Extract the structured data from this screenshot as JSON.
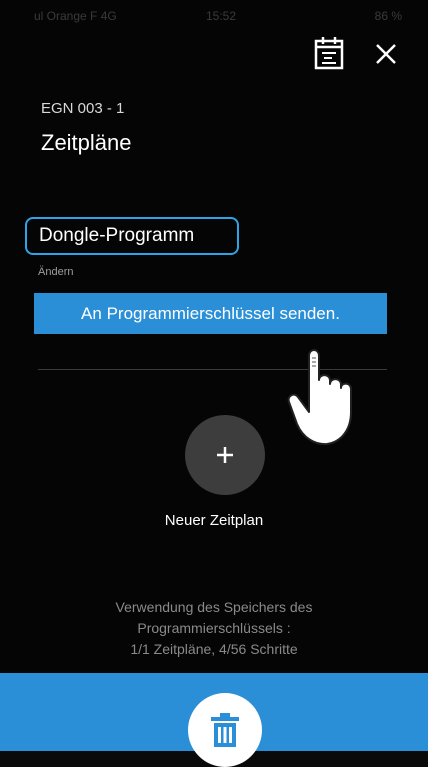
{
  "status_bar": {
    "carrier": "ul Orange F 4G",
    "time": "15:52",
    "battery": "86 %"
  },
  "header": {
    "device_id": "EGN 003 - 1",
    "title": "Zeitpläne",
    "calendar_icon": "calendar-icon",
    "close_icon": "close-icon"
  },
  "program": {
    "name": "Dongle-Programm",
    "change_label": "Ändern",
    "send_button_label": "An Programmierschlüssel senden."
  },
  "new_schedule": {
    "icon": "plus-icon",
    "label": "Neuer Zeitplan"
  },
  "memory_usage": {
    "line1": "Verwendung des Speichers des",
    "line2": "Programmierschlüssels :",
    "line3": "1/1 Zeitpläne, 4/56 Schritte"
  },
  "bottom_bar": {
    "trash_icon": "trash-icon"
  },
  "colors": {
    "accent": "#2a8fd6",
    "outline": "#2ea4e6",
    "background": "#050505"
  }
}
